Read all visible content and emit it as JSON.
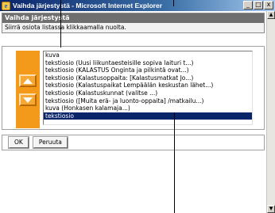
{
  "window": {
    "title": "Vaihda järjestystä - Microsoft Internet Explorer",
    "minimize": "_",
    "maximize": "□",
    "close": "x"
  },
  "dialog": {
    "heading": "Vaihda järjestystä",
    "description": "Siirrä osiota listassa klikkaamalla nuolta."
  },
  "list": {
    "items": [
      "kuva",
      "tekstiosio     (Uusi liikuntaesteisille sopiva laituri t...)",
      "tekstiosio     (KALASTUS Onginta ja pilkintä ovat...)",
      "tekstiosio     (Kalastusoppaita: [Kalastusmatkat Jo...)",
      "tekstiosio     (Kalastuspaikat Lempäälän keskustan lähet...)",
      "tekstiosio     (Kalastuskunnat (valitse ...)",
      "tekstiosio     ([Muita erä- ja luonto-oppaita] /matkailu...)",
      "kuva     (Honkasen kalamaja...)",
      "tekstiosio"
    ],
    "selected_index": 8
  },
  "buttons": {
    "ok": "OK",
    "cancel": "Peruuta"
  },
  "icons": {
    "app": "ie-logo-icon",
    "move_up": "arrow-up-icon",
    "move_down": "arrow-down-icon"
  }
}
